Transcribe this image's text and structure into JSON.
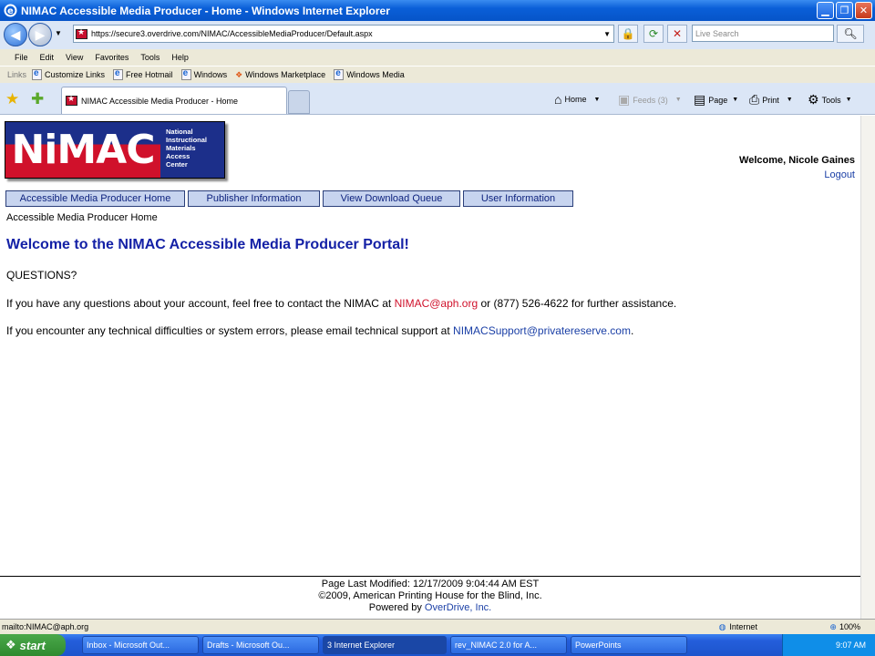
{
  "window": {
    "title": "NIMAC Accessible Media Producer - Home - Windows Internet Explorer"
  },
  "address": {
    "url": "https://secure3.overdrive.com/NIMAC/AccessibleMediaProducer/Default.aspx"
  },
  "search": {
    "placeholder": "Live Search"
  },
  "menu": {
    "items": [
      "File",
      "Edit",
      "View",
      "Favorites",
      "Tools",
      "Help"
    ]
  },
  "links": {
    "label": "Links",
    "items": [
      "Customize Links",
      "Free Hotmail",
      "Windows",
      "Windows Marketplace",
      "Windows Media"
    ]
  },
  "tab": {
    "title": "NIMAC Accessible Media Producer - Home"
  },
  "commandbar": {
    "home": "Home",
    "feeds": "Feeds (3)",
    "page": "Page",
    "print": "Print",
    "tools": "Tools"
  },
  "page": {
    "logo": {
      "main": "NiMAC",
      "sub": [
        "National",
        "Instructional",
        "Materials",
        "Access",
        "Center"
      ]
    },
    "welcome": "Welcome, Nicole Gaines",
    "logout": "Logout",
    "nav": [
      "Accessible Media Producer Home",
      "Publisher Information",
      "View Download Queue",
      "User Information"
    ],
    "breadcrumb": "Accessible Media Producer Home",
    "heading": "Welcome to the NIMAC Accessible Media Producer Portal!",
    "questions": "QUESTIONS?",
    "p1_pre": "If you have any questions about your account, feel free to contact the NIMAC at ",
    "p1_link": "NIMAC@aph.org",
    "p1_post": " or (877) 526-4622 for further assistance.",
    "p2_pre": "If you encounter any technical difficulties or system errors, please email technical support at ",
    "p2_link": "NIMACSupport@privatereserve.com",
    "p2_post": ".",
    "footer": {
      "modified": "Page Last Modified: 12/17/2009 9:04:44 AM EST",
      "copyright": "©2009, American Printing House for the Blind, Inc.",
      "powered_pre": "Powered by ",
      "powered_link": "OverDrive, Inc."
    }
  },
  "status": {
    "text": "mailto:NIMAC@aph.org",
    "zone": "Internet",
    "zoom": "100%"
  },
  "taskbar": {
    "start": "start",
    "tasks": [
      "Inbox - Microsoft Out...",
      "Drafts - Microsoft Ou...",
      "3 Internet Explorer",
      "rev_NIMAC 2.0 for A...",
      "PowerPoints"
    ],
    "clock": "9:07 AM"
  },
  "colors": {
    "heading": "#1421a6",
    "link_red": "#d0112b",
    "link_blue": "#1a3fa6",
    "nav_bg": "#c7d4ef"
  }
}
